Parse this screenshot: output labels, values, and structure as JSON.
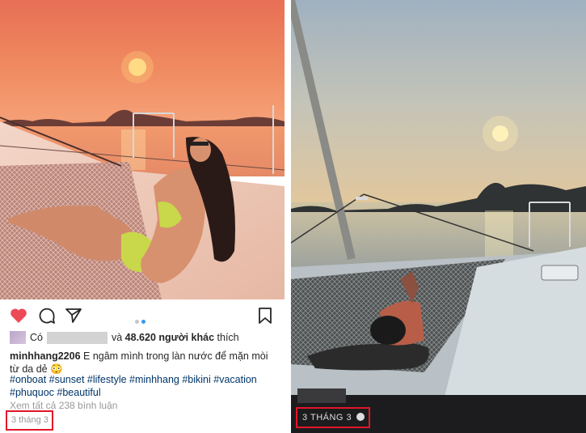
{
  "post": {
    "likes_prefix": "Có",
    "likes_count": "48.620 người khác",
    "likes_and": "và",
    "likes_suffix": "thích",
    "username": "minhhang2206",
    "caption_text": " E ngâm mình trong làn nước để mặn mòi từ da dẻ 😳",
    "hashtags": "#onboat #sunset #lifestyle #minhhang #bikini #vacation #phuquoc #beautiful",
    "comments_link": "Xem tất cả 238 bình luận",
    "date": "3 tháng 3"
  },
  "story": {
    "date": "3 THÁNG 3"
  },
  "icons": {
    "like": "heart-icon",
    "comment": "comment-icon",
    "share": "share-icon",
    "save": "bookmark-icon",
    "globe": "globe-icon"
  },
  "colors": {
    "like_red": "#ed4956",
    "hashtag_blue": "#003569",
    "highlight_red": "#e3152a",
    "carousel_active": "#3897f0"
  }
}
